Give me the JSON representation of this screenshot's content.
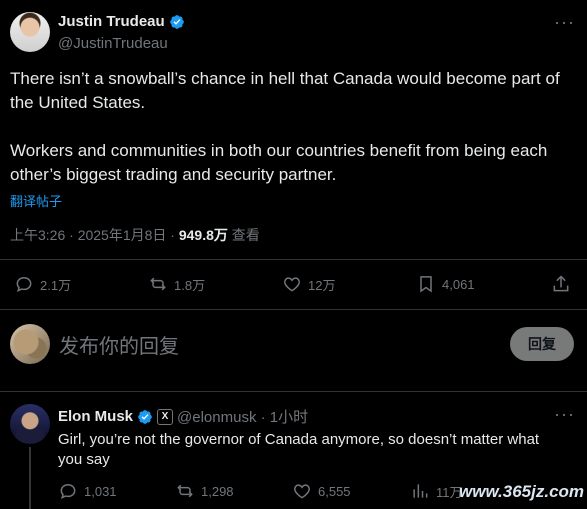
{
  "tweet": {
    "author_name": "Justin Trudeau",
    "author_handle": "@JustinTrudeau",
    "paragraph1": "There isn’t a snowball’s chance in hell that Canada would become part of the United States.",
    "paragraph2": "Workers and communities in both our countries benefit from being each other’s biggest trading and security partner.",
    "translate_label": "翻译帖子",
    "time": "上午3:26 · 2025年1月8日 · ",
    "views_count": "949.8万",
    "views_label": " 查看",
    "actions": {
      "replies": "2.1万",
      "reposts": "1.8万",
      "likes": "12万",
      "bookmarks": "4,061"
    }
  },
  "reply_box": {
    "placeholder": "发布你的回复",
    "button": "回复"
  },
  "reply": {
    "author_name": "Elon Musk",
    "badge": "X",
    "handle_time": "@elonmusk · 1小时",
    "text": "Girl, you’re not the governor of Canada anymore, so doesn’t matter what you say",
    "actions": {
      "replies": "1,031",
      "reposts": "1,298",
      "likes": "6,555",
      "views": "11万"
    }
  },
  "watermark": "www.365jz.com",
  "colors": {
    "background": "#000000",
    "text": "#e7e9ea",
    "muted": "#71767b",
    "accent": "#1d9bf0",
    "verified": "#1d9bf0"
  }
}
